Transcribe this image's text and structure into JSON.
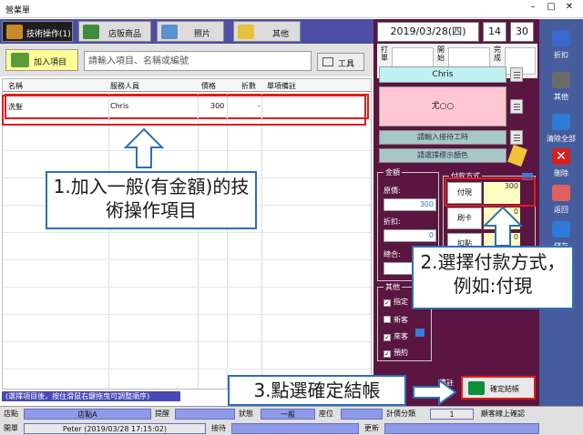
{
  "window": {
    "title": "營業單"
  },
  "tabs": [
    {
      "label": "技術操作(1)"
    },
    {
      "label": "店販商品"
    },
    {
      "label": "照片"
    },
    {
      "label": "其他"
    }
  ],
  "toolbar": {
    "add_item": "加入項目",
    "search_placeholder": "請輸入項目、名稱或編號",
    "tools": "工具"
  },
  "grid": {
    "columns": [
      "名稱",
      "服務人員",
      "價格",
      "折數",
      "單項備註"
    ],
    "rows": [
      {
        "name": "洗髮",
        "staff": "Chris",
        "price": "300",
        "discount": "-",
        "note": ""
      }
    ]
  },
  "hint": "(選擇項目後，按住滑鼠右鍵拖曳可調整順序)",
  "right": {
    "date": "2019/03/28(四)",
    "hour": "14",
    "minute": "30",
    "check_in": "打單",
    "open": "開始",
    "done": "完成",
    "staff": "Chris",
    "customer": "尤○○",
    "designate_btn": "請輸入接待工時",
    "color_btn": "請選擇標示顏色",
    "amount": {
      "legend": "金額",
      "original_label": "原價:",
      "original": "300",
      "discount_label": "折扣:",
      "discount": "0",
      "total_label": "總合:",
      "total": ""
    },
    "payment": {
      "legend": "付款方式",
      "cash": "付現",
      "cash_amount": "300",
      "card": "刷卡",
      "card_amount": "0",
      "other": "扣點",
      "other_amount": "0"
    },
    "other": {
      "legend": "其他",
      "items": [
        {
          "label": "指定",
          "checked": true
        },
        {
          "label": "新客",
          "checked": false
        },
        {
          "label": "來客",
          "checked": true
        },
        {
          "label": "預約",
          "checked": true
        }
      ]
    },
    "mid_label": "備註",
    "confirm": "確定結帳"
  },
  "sidebar": [
    {
      "label": "折扣",
      "color": "#3a6ad0"
    },
    {
      "label": "其他",
      "color": "#6b6b6b"
    },
    {
      "label": "清除全部",
      "color": "#2e7bd8"
    },
    {
      "label": "刪除",
      "color": "#d81f1f"
    },
    {
      "label": "返回",
      "color": "#e06060"
    },
    {
      "label": "儲存",
      "color": "#2e7bd8"
    }
  ],
  "status": {
    "store_label": "店點",
    "store": "店點A",
    "remind_label": "提醒",
    "remind": "",
    "state_label": "狀態",
    "state": "一般",
    "seat_label": "座位",
    "seat": "",
    "count_label": "計價分類",
    "count": "1",
    "confirm_label": "顧客線上確認",
    "open_label": "開單",
    "opener": "Peter (2019/03/28 17:15:02)",
    "receive_label": "接待",
    "receive": "",
    "update_label": "更新",
    "update": ""
  },
  "annotations": {
    "step1": "1.加入一般(有金額)的技術操作項目",
    "step2": "2.選擇付款方式，例如:付現",
    "step3": "3.點選確定結帳"
  },
  "colors": {
    "accent_red": "#e41b1b",
    "callout_border": "#2e6fb5",
    "panel": "#5a1640",
    "sidebar": "#475c9c"
  }
}
